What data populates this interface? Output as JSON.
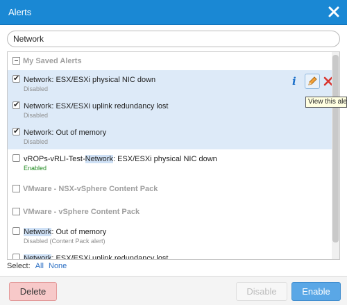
{
  "window": {
    "title": "Alerts"
  },
  "search": {
    "value": "Network"
  },
  "groups": [
    {
      "label": "My Saved Alerts"
    },
    {
      "label": "VMware - NSX-vSphere Content Pack"
    },
    {
      "label": "VMware - vSphere Content Pack"
    }
  ],
  "rows": [
    {
      "name": "Network: ESX/ESXi physical NIC down",
      "status": "Disabled"
    },
    {
      "name": "Network: ESX/ESXi uplink redundancy lost",
      "status": "Disabled"
    },
    {
      "name": "Network: Out of memory",
      "status": "Disabled"
    },
    {
      "name_pre": "vROPs-vRLI-Test-",
      "name_hl": "Network",
      "name_post": ": ESX/ESXi physical NIC down",
      "status": "Enabled"
    },
    {
      "name_hl": "Network",
      "name_post": ": Out of memory",
      "status": "Disabled (Content Pack alert)"
    },
    {
      "name_hl": "Network",
      "name_post": ": ESX/ESXi uplink redundancy lost"
    }
  ],
  "row_actions": {
    "info": "i"
  },
  "tooltip": {
    "text": "View this ale"
  },
  "select_bar": {
    "label": "Select:",
    "all": "All",
    "none": "None"
  },
  "buttons": {
    "delete": "Delete",
    "disable": "Disable",
    "enable": "Enable"
  },
  "colors": {
    "titlebar": "#1a88d4",
    "selected_row": "#ddeaf8",
    "enable_btn": "#5aa7e6",
    "delete_btn": "#f7c9c9",
    "enabled_text": "#1f8a1f"
  },
  "icons": [
    "close-icon",
    "info-icon",
    "edit-pencil-icon",
    "delete-x-icon"
  ]
}
